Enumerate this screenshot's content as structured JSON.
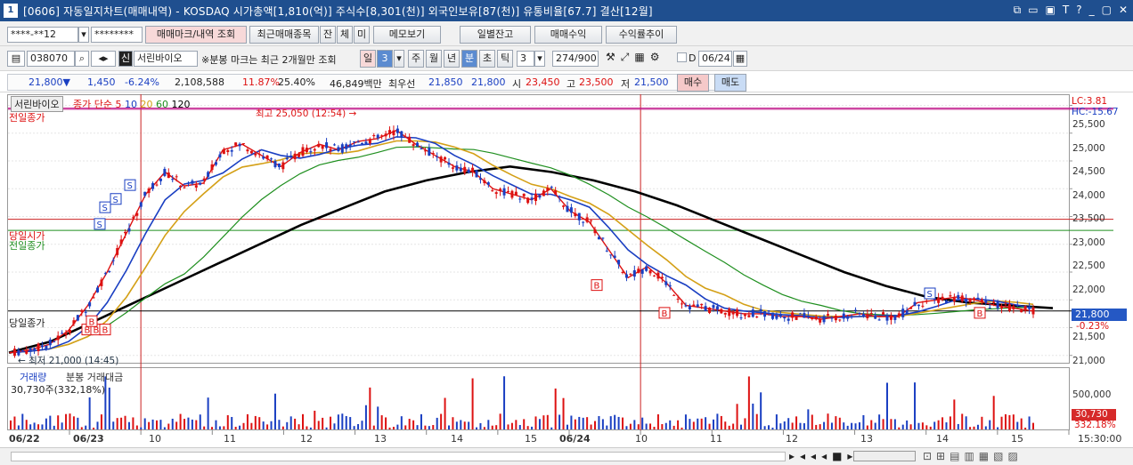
{
  "titlebar": {
    "window_num": "1",
    "title": "[0606] 자동일지차트(매매내역) - KOSDAQ 시가총액[1,810(억)] 주식수[8,301(천)] 외국인보유[87(천)] 유통비율[67.7] 결산[12월]",
    "controls": [
      "⧉",
      "▭",
      "▣",
      "T",
      "?",
      "_",
      "▢",
      "✕"
    ]
  },
  "toolbar1": {
    "account": "****-**12",
    "password": "********",
    "btn_trade_mark": "매매마크/내역 조회",
    "btn_recent": "최근매매종목",
    "btn_jan": "잔",
    "btn_che": "체",
    "btn_mi": "미",
    "btn_memo": "메모보기",
    "btn_daily": "일별잔고",
    "btn_profit": "매매수익",
    "btn_rate": "수익률추이"
  },
  "toolbar2": {
    "code": "038070",
    "badge": "신",
    "name": "서린바이오",
    "note": "※분봉 마크는 최근 2개월만 조회",
    "period_day": "일",
    "period_val": "3",
    "week": "주",
    "month": "월",
    "year": "년",
    "minute": "분",
    "second": "초",
    "tick": "틱",
    "tick_val": "3",
    "count": "274/900",
    "date_prefix": "D",
    "date": "06/24"
  },
  "quote": {
    "price": "21,800▼",
    "change": "1,450",
    "change_pct": "-6.24%",
    "volume": "2,108,588",
    "rate1": "11.87%",
    "rate2": "25.40%",
    "amount": "46,849백만",
    "best_label": "최우선",
    "best_ask": "21,850",
    "best_bid": "21,800",
    "open_label": "시",
    "open": "23,450",
    "high_label": "고",
    "high": "23,500",
    "low_label": "저",
    "low": "21,500",
    "buy": "매수",
    "sell": "매도"
  },
  "chart_header": {
    "name": "서린바이오",
    "series_label": "종가 단순",
    "ma_periods": [
      "5",
      "10",
      "20",
      "60",
      "120"
    ],
    "ma_colors": [
      "#d11",
      "#1a3fc2",
      "#d4a017",
      "#1f8f1f",
      "#000"
    ],
    "lc": "LC:3.81",
    "hc": "HC:-15.67"
  },
  "annotations": {
    "prev_close_top": "전일종가",
    "high_mark": "최고 25,050 (12:54) →",
    "today_open": "당일시가",
    "prev_close": "전일종가",
    "today_close": "당일종가",
    "low_mark": "← 최저 21,000 (14:45)",
    "buy_marks": [
      "B",
      "B",
      "B",
      "B",
      "B",
      "B",
      "B"
    ],
    "sell_marks": [
      "S",
      "S",
      "S",
      "S",
      "S"
    ]
  },
  "price_axis": [
    "25,500",
    "25,000",
    "24,500",
    "24,000",
    "23,500",
    "23,000",
    "22,500",
    "22,000",
    "21,500",
    "21,000"
  ],
  "price_badge": {
    "value": "21,800",
    "pct": "-0.23%"
  },
  "volume_panel": {
    "label1": "거래량",
    "label2": "분봉 거래대금",
    "value": "30,730주(332,18%)",
    "axis": "500,000",
    "badge": "30,730",
    "pct": "332.18%"
  },
  "x_axis": {
    "labels": [
      "06/22",
      "06/23",
      "10",
      "11",
      "12",
      "13",
      "14",
      "15",
      "06/24",
      "10",
      "11",
      "12",
      "13",
      "14",
      "15"
    ],
    "time": "15:30:00"
  },
  "chart_data": {
    "type": "candlestick",
    "title": "",
    "xlabel": "",
    "ylabel": "",
    "ylim": [
      20900,
      25700
    ],
    "session_marks": [
      "06/22",
      "06/23",
      "10",
      "11",
      "12",
      "13",
      "14",
      "15",
      "06/24",
      "10",
      "11",
      "12",
      "13",
      "14",
      "15"
    ],
    "price_close_path": [
      21050,
      21100,
      21200,
      21450,
      21900,
      22500,
      23200,
      23900,
      24300,
      24050,
      24100,
      24700,
      24800,
      24600,
      24400,
      24650,
      24800,
      24700,
      24850,
      24900,
      25050,
      24800,
      24600,
      24400,
      24300,
      24000,
      23900,
      23800,
      24000,
      23600,
      23400,
      22900,
      22400,
      22600,
      22300,
      21900,
      21850,
      21800,
      21750,
      21750,
      21700,
      21700,
      21650,
      21700,
      21750,
      21700,
      21700,
      21950,
      22000,
      22050,
      22000,
      21900,
      21850,
      21800
    ],
    "ma120_path": [
      21050,
      21250,
      21600,
      21950,
      22300,
      22650,
      23000,
      23350,
      23650,
      23950,
      24150,
      24300,
      24400,
      24300,
      24150,
      23950,
      23700,
      23400,
      23100,
      22800,
      22500,
      22250,
      22050,
      21950,
      21900,
      21850
    ],
    "levels": {
      "today_open": 23450,
      "prev_close": 23250,
      "today_close": 21800,
      "high": 25050,
      "low": 21000
    }
  }
}
